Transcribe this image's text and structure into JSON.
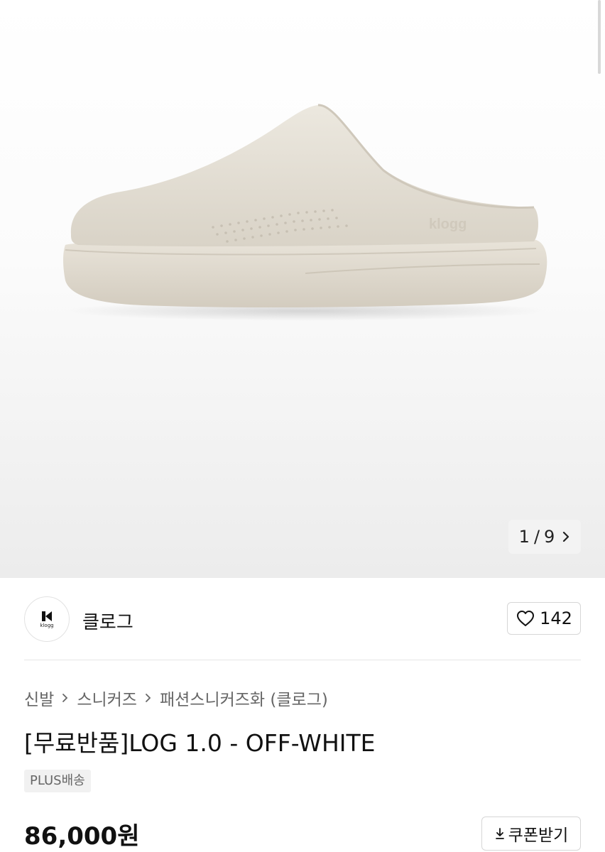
{
  "gallery": {
    "current_page": "1",
    "separator": "/",
    "total_pages": "9",
    "image_alt": "off-white slip-on mule shoe",
    "shoe_logo_text": "klogg"
  },
  "brand": {
    "name": "클로그",
    "logo_text": "klogg",
    "like_count": "142"
  },
  "breadcrumb": [
    "신발",
    "스니커즈",
    "패션스니커즈화 (클로그)"
  ],
  "product": {
    "title": "[무료반품]LOG 1.0 - OFF-WHITE",
    "shipping_badge": "PLUS배송",
    "price": "86,000원",
    "coupon_label": "쿠폰받기"
  },
  "colors": {
    "shoe_body": "#e4dfd5",
    "hero_bottom": "#ececec",
    "border": "#d6d6d6"
  }
}
